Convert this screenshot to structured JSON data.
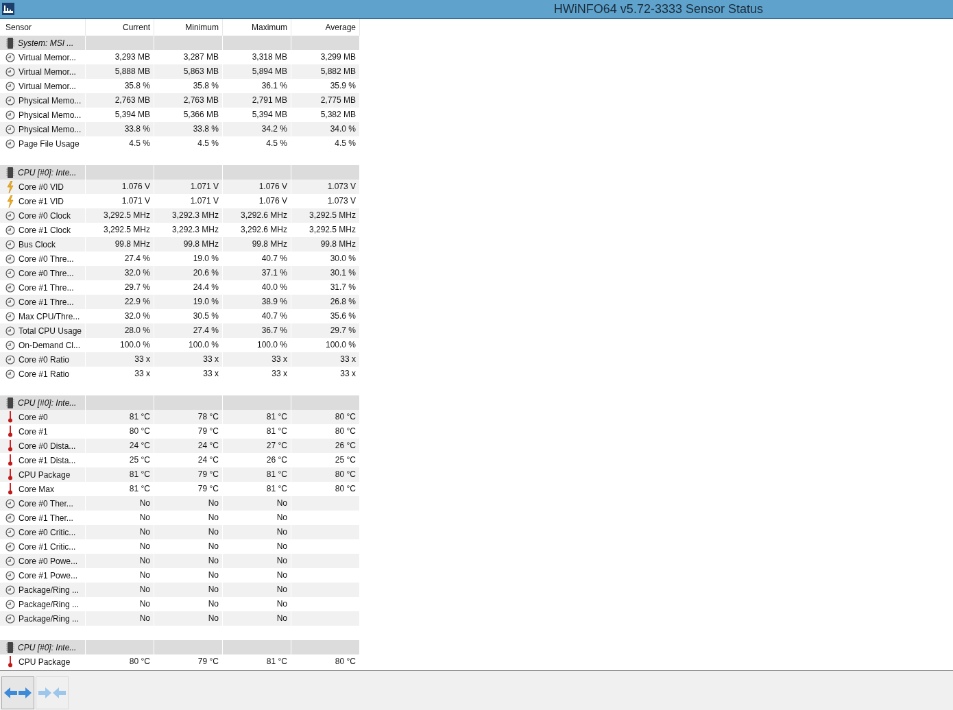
{
  "window": {
    "title": "HWiNFO64 v5.72-3333 Sensor Status"
  },
  "table": {
    "columns": [
      "Sensor",
      "Current",
      "Minimum",
      "Maximum",
      "Average"
    ],
    "rows": [
      {
        "kind": "group",
        "name": "System: MSI ..."
      },
      {
        "kind": "usage",
        "cells": [
          "Virtual Memor...",
          "3,293 MB",
          "3,287 MB",
          "3,318 MB",
          "3,299 MB"
        ]
      },
      {
        "kind": "usage",
        "cells": [
          "Virtual Memor...",
          "5,888 MB",
          "5,863 MB",
          "5,894 MB",
          "5,882 MB"
        ]
      },
      {
        "kind": "usage",
        "cells": [
          "Virtual Memor...",
          "35.8 %",
          "35.8 %",
          "36.1 %",
          "35.9 %"
        ]
      },
      {
        "kind": "usage",
        "cells": [
          "Physical Memo...",
          "2,763 MB",
          "2,763 MB",
          "2,791 MB",
          "2,775 MB"
        ]
      },
      {
        "kind": "usage",
        "cells": [
          "Physical Memo...",
          "5,394 MB",
          "5,366 MB",
          "5,394 MB",
          "5,382 MB"
        ]
      },
      {
        "kind": "usage",
        "cells": [
          "Physical Memo...",
          "33.8 %",
          "33.8 %",
          "34.2 %",
          "34.0 %"
        ]
      },
      {
        "kind": "usage",
        "cells": [
          "Page File Usage",
          "4.5 %",
          "4.5 %",
          "4.5 %",
          "4.5 %"
        ]
      },
      {
        "kind": "blank"
      },
      {
        "kind": "group",
        "name": "CPU [#0]: Inte..."
      },
      {
        "kind": "voltage",
        "cells": [
          "Core #0 VID",
          "1.076 V",
          "1.071 V",
          "1.076 V",
          "1.073 V"
        ]
      },
      {
        "kind": "voltage",
        "cells": [
          "Core #1 VID",
          "1.071 V",
          "1.071 V",
          "1.076 V",
          "1.073 V"
        ]
      },
      {
        "kind": "usage",
        "cells": [
          "Core #0 Clock",
          "3,292.5 MHz",
          "3,292.3 MHz",
          "3,292.6 MHz",
          "3,292.5 MHz"
        ]
      },
      {
        "kind": "usage",
        "cells": [
          "Core #1 Clock",
          "3,292.5 MHz",
          "3,292.3 MHz",
          "3,292.6 MHz",
          "3,292.5 MHz"
        ]
      },
      {
        "kind": "usage",
        "cells": [
          "Bus Clock",
          "99.8 MHz",
          "99.8 MHz",
          "99.8 MHz",
          "99.8 MHz"
        ]
      },
      {
        "kind": "usage",
        "cells": [
          "Core #0 Thre...",
          "27.4 %",
          "19.0 %",
          "40.7 %",
          "30.0 %"
        ]
      },
      {
        "kind": "usage",
        "cells": [
          "Core #0 Thre...",
          "32.0 %",
          "20.6 %",
          "37.1 %",
          "30.1 %"
        ]
      },
      {
        "kind": "usage",
        "cells": [
          "Core #1 Thre...",
          "29.7 %",
          "24.4 %",
          "40.0 %",
          "31.7 %"
        ]
      },
      {
        "kind": "usage",
        "cells": [
          "Core #1 Thre...",
          "22.9 %",
          "19.0 %",
          "38.9 %",
          "26.8 %"
        ]
      },
      {
        "kind": "usage",
        "cells": [
          "Max CPU/Thre...",
          "32.0 %",
          "30.5 %",
          "40.7 %",
          "35.6 %"
        ]
      },
      {
        "kind": "usage",
        "cells": [
          "Total CPU Usage",
          "28.0 %",
          "27.4 %",
          "36.7 %",
          "29.7 %"
        ]
      },
      {
        "kind": "usage",
        "cells": [
          "On-Demand Cl...",
          "100.0 %",
          "100.0 %",
          "100.0 %",
          "100.0 %"
        ]
      },
      {
        "kind": "usage",
        "cells": [
          "Core #0 Ratio",
          "33 x",
          "33 x",
          "33 x",
          "33 x"
        ]
      },
      {
        "kind": "usage",
        "cells": [
          "Core #1 Ratio",
          "33 x",
          "33 x",
          "33 x",
          "33 x"
        ]
      },
      {
        "kind": "blank"
      },
      {
        "kind": "group",
        "name": "CPU [#0]: Inte..."
      },
      {
        "kind": "temperature",
        "cells": [
          "Core #0",
          "81 °C",
          "78 °C",
          "81 °C",
          "80 °C"
        ]
      },
      {
        "kind": "temperature",
        "cells": [
          "Core #1",
          "80 °C",
          "79 °C",
          "81 °C",
          "80 °C"
        ]
      },
      {
        "kind": "temperature",
        "cells": [
          "Core #0 Dista...",
          "24 °C",
          "24 °C",
          "27 °C",
          "26 °C"
        ]
      },
      {
        "kind": "temperature",
        "cells": [
          "Core #1 Dista...",
          "25 °C",
          "24 °C",
          "26 °C",
          "25 °C"
        ]
      },
      {
        "kind": "temperature",
        "cells": [
          "CPU Package",
          "81 °C",
          "79 °C",
          "81 °C",
          "80 °C"
        ]
      },
      {
        "kind": "temperature",
        "cells": [
          "Core Max",
          "81 °C",
          "79 °C",
          "81 °C",
          "80 °C"
        ]
      },
      {
        "kind": "usage",
        "cells": [
          "Core #0 Ther...",
          "No",
          "No",
          "No"
        ]
      },
      {
        "kind": "usage",
        "cells": [
          "Core #1 Ther...",
          "No",
          "No",
          "No"
        ]
      },
      {
        "kind": "usage",
        "cells": [
          "Core #0 Critic...",
          "No",
          "No",
          "No"
        ]
      },
      {
        "kind": "usage",
        "cells": [
          "Core #1 Critic...",
          "No",
          "No",
          "No"
        ]
      },
      {
        "kind": "usage",
        "cells": [
          "Core #0 Powe...",
          "No",
          "No",
          "No"
        ]
      },
      {
        "kind": "usage",
        "cells": [
          "Core #1 Powe...",
          "No",
          "No",
          "No"
        ]
      },
      {
        "kind": "usage",
        "cells": [
          "Package/Ring ...",
          "No",
          "No",
          "No"
        ]
      },
      {
        "kind": "usage",
        "cells": [
          "Package/Ring ...",
          "No",
          "No",
          "No"
        ]
      },
      {
        "kind": "usage",
        "cells": [
          "Package/Ring ...",
          "No",
          "No",
          "No"
        ]
      },
      {
        "kind": "blank"
      },
      {
        "kind": "group",
        "name": "CPU [#0]: Inte..."
      },
      {
        "kind": "temperature",
        "cells": [
          "CPU Package",
          "80 °C",
          "79 °C",
          "81 °C",
          "80 °C"
        ]
      }
    ]
  }
}
